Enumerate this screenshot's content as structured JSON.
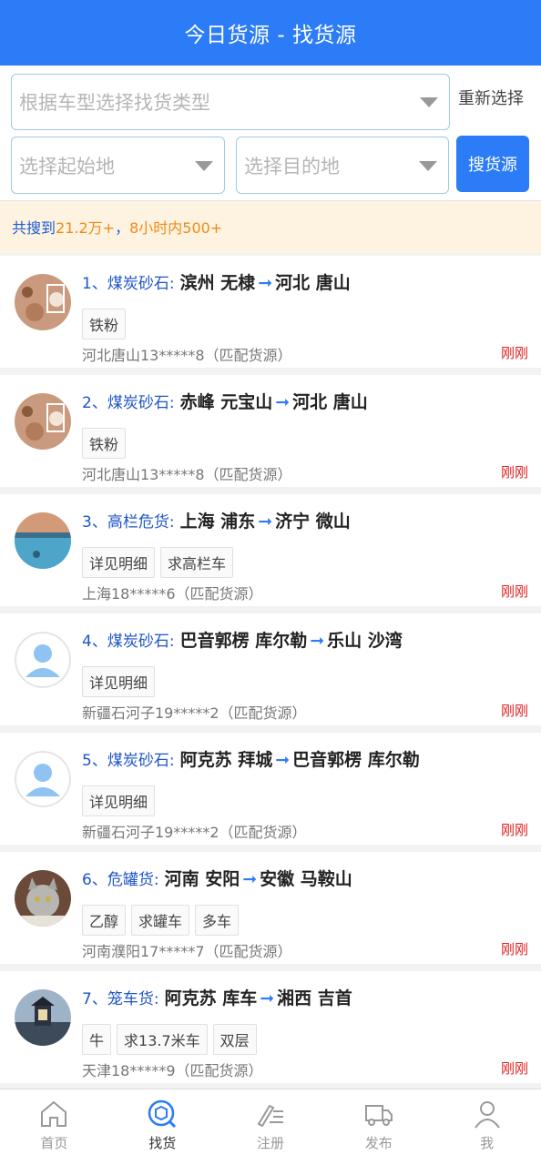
{
  "header": {
    "title": "今日货源 - 找货源"
  },
  "filters": {
    "vehicle_type_placeholder": "根据车型选择找货类型",
    "reselect_label": "重新选择",
    "origin_placeholder": "选择起始地",
    "destination_placeholder": "选择目的地",
    "search_label": "搜货源"
  },
  "summary": {
    "prefix": "共搜到",
    "total": "21.2万+",
    "sep": "，",
    "window": "8小时内",
    "recent": "500+"
  },
  "arrow": "➞",
  "listings": [
    {
      "num": "1、",
      "category": "煤炭砂石:",
      "from": "滨州 无棣",
      "to": "河北 唐山",
      "tags": [
        "铁粉"
      ],
      "poster": "河北唐山13*****8（匹配货源）",
      "time": "刚刚"
    },
    {
      "num": "2、",
      "category": "煤炭砂石:",
      "from": "赤峰 元宝山",
      "to": "河北 唐山",
      "tags": [
        "铁粉"
      ],
      "poster": "河北唐山13*****8（匹配货源）",
      "time": "刚刚"
    },
    {
      "num": "3、",
      "category": "高栏危货:",
      "from": "上海 浦东",
      "to": "济宁 微山",
      "tags": [
        "详见明细",
        "求高栏车"
      ],
      "poster": "上海18*****6（匹配货源）",
      "time": "刚刚"
    },
    {
      "num": "4、",
      "category": "煤炭砂石:",
      "from": "巴音郭楞 库尔勒",
      "to": "乐山 沙湾",
      "tags": [
        "详见明细"
      ],
      "poster": "新疆石河子19*****2（匹配货源）",
      "time": "刚刚"
    },
    {
      "num": "5、",
      "category": "煤炭砂石:",
      "from": "阿克苏 拜城",
      "to": "巴音郭楞 库尔勒",
      "tags": [
        "详见明细"
      ],
      "poster": "新疆石河子19*****2（匹配货源）",
      "time": "刚刚"
    },
    {
      "num": "6、",
      "category": "危罐货:",
      "from": "河南 安阳",
      "to": "安徽 马鞍山",
      "tags": [
        "乙醇",
        "求罐车",
        "多车"
      ],
      "poster": "河南濮阳17*****7（匹配货源）",
      "time": "刚刚"
    },
    {
      "num": "7、",
      "category": "笼车货:",
      "from": "阿克苏 库车",
      "to": "湘西 吉首",
      "tags": [
        "牛",
        "求13.7米车",
        "双层"
      ],
      "poster": "天津18*****9（匹配货源）",
      "time": "刚刚"
    }
  ],
  "tabs": [
    {
      "label": "首页",
      "icon": "home-icon"
    },
    {
      "label": "找货",
      "icon": "find-cargo-icon"
    },
    {
      "label": "注册",
      "icon": "register-icon"
    },
    {
      "label": "发布",
      "icon": "truck-icon"
    },
    {
      "label": "我",
      "icon": "user-icon"
    }
  ],
  "colors": {
    "primary": "#2b7cf6",
    "time": "#e02020",
    "highlight": "#f08a17",
    "category": "#1e55c8"
  }
}
